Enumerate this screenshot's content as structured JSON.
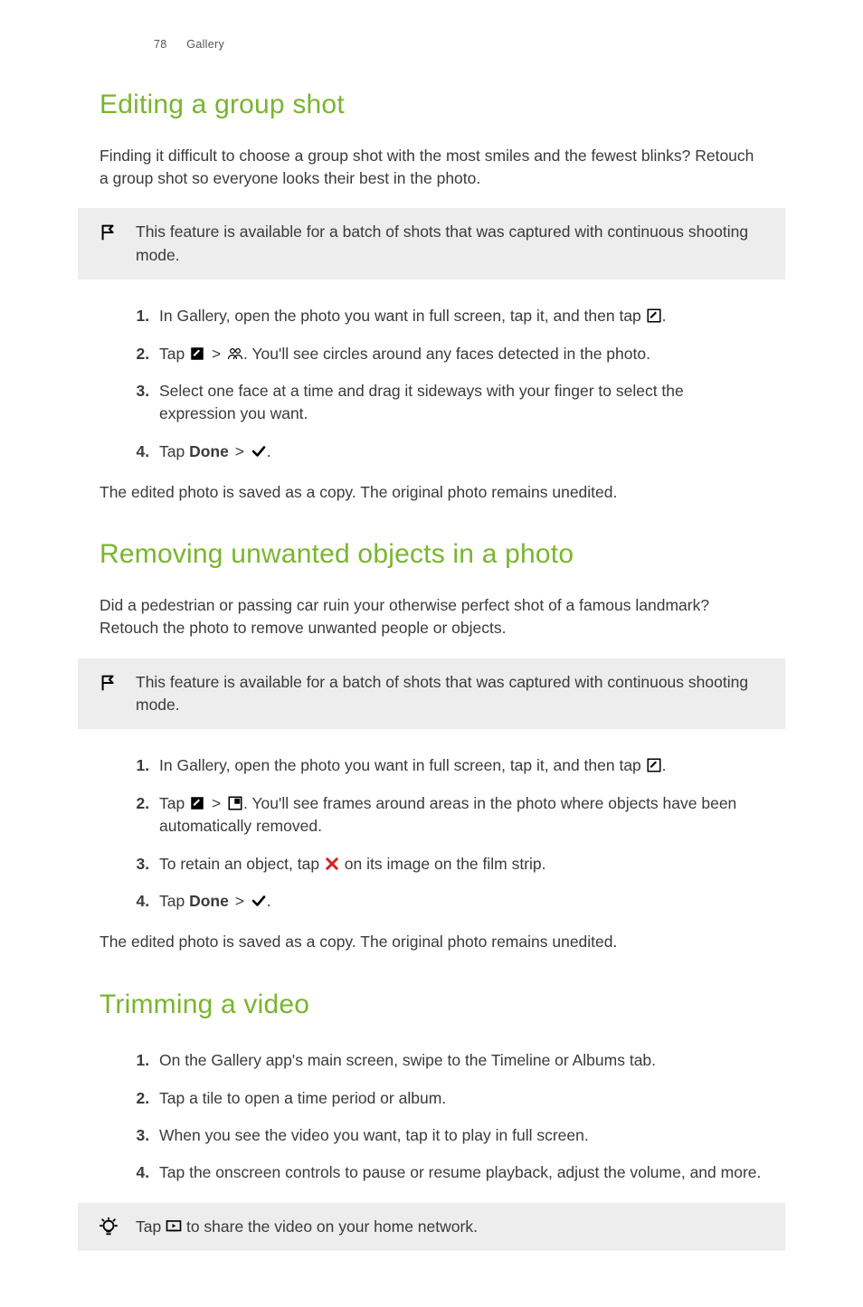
{
  "header": {
    "page_number": "78",
    "section": "Gallery"
  },
  "s1": {
    "title": "Editing a group shot",
    "intro": "Finding it difficult to choose a group shot with the most smiles and the fewest blinks? Retouch a group shot so everyone looks their best in the photo.",
    "callout": "This feature is available for a batch of shots that was captured with continuous shooting mode.",
    "steps": {
      "1": {
        "pre": "In Gallery, open the photo you want in full screen, tap it, and then tap ",
        "post": "."
      },
      "2": {
        "pre": "Tap ",
        "mid": " > ",
        "post": ". You'll see circles around any faces detected in the photo."
      },
      "3": "Select one face at a time and drag it sideways with your finger to select the expression you want.",
      "4": {
        "pre": "Tap ",
        "done": "Done",
        "mid": " > ",
        "post": "."
      }
    },
    "closing": "The edited photo is saved as a copy. The original photo remains unedited."
  },
  "s2": {
    "title": "Removing unwanted objects in a photo",
    "intro": "Did a pedestrian or passing car ruin your otherwise perfect shot of a famous landmark? Retouch the photo to remove unwanted people or objects.",
    "callout": "This feature is available for a batch of shots that was captured with continuous shooting mode.",
    "steps": {
      "1": {
        "pre": "In Gallery, open the photo you want in full screen, tap it, and then tap ",
        "post": "."
      },
      "2": {
        "pre": "Tap ",
        "mid": " > ",
        "post": ". You'll see frames around areas in the photo where objects have been automatically removed."
      },
      "3": {
        "pre": "To retain an object, tap ",
        "post": " on its image on the film strip."
      },
      "4": {
        "pre": "Tap ",
        "done": "Done",
        "mid": " > ",
        "post": "."
      }
    },
    "closing": "The edited photo is saved as a copy. The original photo remains unedited."
  },
  "s3": {
    "title": "Trimming a video",
    "steps": {
      "1": "On the Gallery app's main screen, swipe to the Timeline or Albums tab.",
      "2": "Tap a tile to open a time period or album.",
      "3": "When you see the video you want, tap it to play in full screen.",
      "4": "Tap the onscreen controls to pause or resume playback, adjust the volume, and more."
    },
    "tip": {
      "pre": "Tap ",
      "post": " to share the video on your home network."
    }
  }
}
